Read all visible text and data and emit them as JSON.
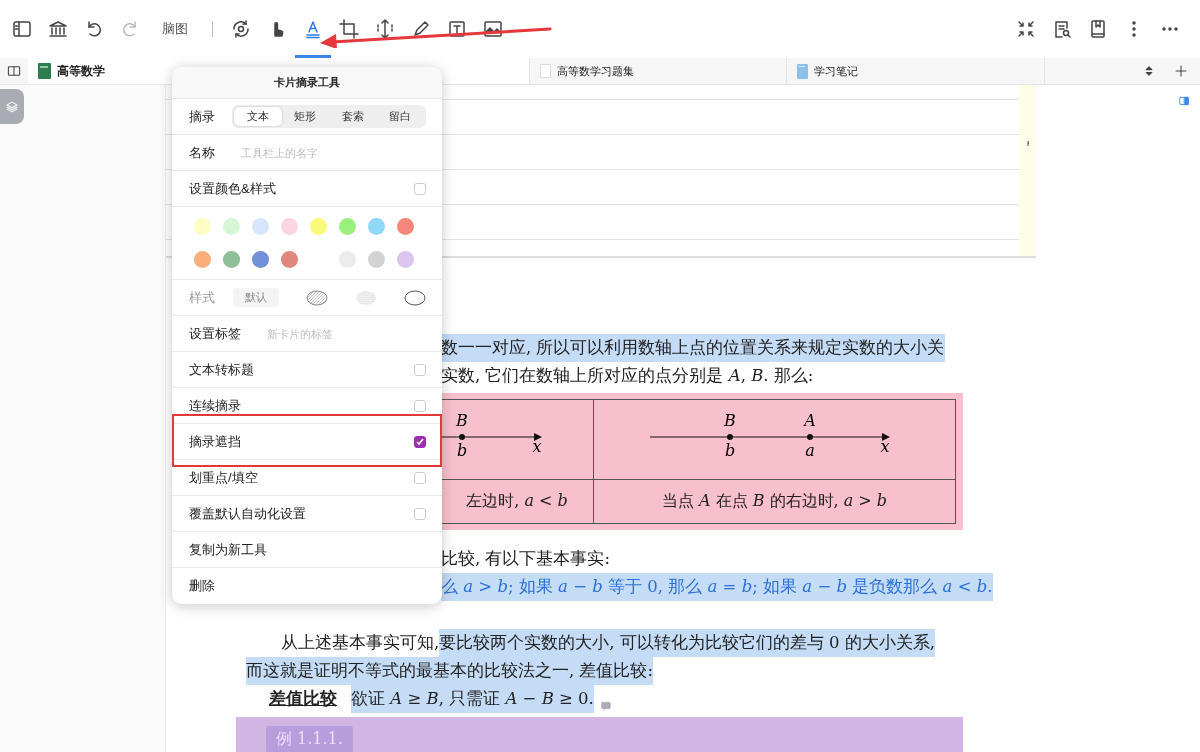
{
  "toolbar": {
    "history": [
      {
        "disabled": false
      },
      {
        "disabled": true
      }
    ],
    "mode_button": "脑图",
    "tools": [
      {
        "selected": false
      },
      {
        "selected": false
      },
      {
        "selected": true
      },
      {
        "selected": false
      },
      {
        "selected": false
      },
      {
        "selected": false
      },
      {
        "selected": false
      },
      {
        "selected": false
      }
    ]
  },
  "tabs": [
    {
      "kind": "book",
      "label": "高等数学",
      "selected": true
    },
    {
      "kind": "page",
      "label": "高等数学习题集",
      "selected": false
    },
    {
      "kind": "notebook",
      "label": "学习笔记",
      "selected": false
    }
  ],
  "document": {
    "lines": [
      {
        "kind": "fragment",
        "segments": [
          {
            "kind": "highlight",
            "text": "数一一对应, 所以可以利用数轴上点的位置关系来规定实数的大小关"
          }
        ]
      },
      {
        "kind": "fragment",
        "segments": [
          {
            "kind": "plain",
            "text": "实数, 它们在数轴上所对应的点分别是 *A*, *B*. 那么:"
          }
        ]
      }
    ],
    "table": {
      "diagrams": [
        {
          "axis": "x",
          "points": [
            {
              "above": "B",
              "below": "b"
            }
          ]
        },
        {
          "axis": "x",
          "points": [
            {
              "above": "B",
              "below": "b"
            },
            {
              "above": "A",
              "below": "a"
            }
          ]
        }
      ],
      "captions": [
        "左边时, *a* < *b*",
        "当点 *A* 在点 *B* 的右边时, *a* > *b*"
      ]
    },
    "lines_after": [
      {
        "kind": "fragment",
        "segments": [
          {
            "kind": "plain",
            "text": "比较, 有以下基本事实:"
          }
        ]
      },
      {
        "kind": "fragment",
        "segments": [
          {
            "kind": "highlight-blue",
            "text": "么 *a* > *b*; 如果 *a* − *b* 等于 0, 那么 *a* = *b*; 如果 *a* − *b* 是负数那么 *a* < *b*."
          }
        ]
      },
      {
        "kind": "blank"
      },
      {
        "kind": "indent",
        "segments": [
          {
            "kind": "plain",
            "text": "从上述基本事实可知, "
          },
          {
            "kind": "highlight",
            "text": "要比较两个实数的大小, 可以转化为比较它们的差与 0 的大小关系,"
          }
        ]
      },
      {
        "kind": "plain",
        "segments": [
          {
            "kind": "highlight",
            "text": "而这就是证明不等式的最基本的比较法之一, 差值比较:"
          }
        ]
      },
      {
        "kind": "definition",
        "segments": [
          {
            "kind": "term",
            "text": "差值比较"
          },
          {
            "kind": "highlight",
            "text": "欲证 *A* ≥ *B*, 只需证 *A* − *B* ≥ 0."
          }
        ]
      }
    ],
    "example": {
      "label": "例 1.1.1."
    }
  },
  "popup": {
    "title": "卡片摘录工具",
    "rows": [
      {
        "kind": "segmented",
        "label": "摘录",
        "options": [
          {
            "label": "文本",
            "selected": true
          },
          {
            "label": "矩形",
            "selected": false
          },
          {
            "label": "套索",
            "selected": false
          },
          {
            "label": "留白",
            "selected": false
          }
        ]
      },
      {
        "kind": "field",
        "label": "名称",
        "placeholder": "工具栏上的名字"
      },
      {
        "kind": "checkbox",
        "label": "设置颜色&样式",
        "checked": false
      },
      {
        "kind": "palette",
        "swatches": [
          {
            "kind": "swatch",
            "color": "#fdfdc4"
          },
          {
            "kind": "swatch",
            "color": "#d5f7d5"
          },
          {
            "kind": "swatch",
            "color": "#d7e6fb"
          },
          {
            "kind": "swatch",
            "color": "#fbd5df"
          },
          {
            "kind": "swatch",
            "color": "#fbf97a"
          },
          {
            "kind": "swatch",
            "color": "#9af07f"
          },
          {
            "kind": "swatch",
            "color": "#8fd8f8"
          },
          {
            "kind": "swatch",
            "color": "#f6857a"
          },
          {
            "kind": "swatch",
            "color": "#f9ae7c"
          },
          {
            "kind": "swatch",
            "color": "#8fbf97"
          },
          {
            "kind": "swatch",
            "color": "#7390d9"
          },
          {
            "kind": "swatch",
            "color": "#e0877d"
          },
          {
            "kind": "blank"
          },
          {
            "kind": "swatch",
            "color": "#ececec"
          },
          {
            "kind": "swatch",
            "color": "#d3d3d3"
          },
          {
            "kind": "swatch",
            "color": "#dbc5ee"
          }
        ]
      },
      {
        "kind": "styles",
        "label": "样式",
        "disabled": true,
        "options": [
          {
            "kind": "text",
            "label": "默认"
          },
          {
            "kind": "hatched"
          },
          {
            "kind": "dotted"
          },
          {
            "kind": "outline"
          }
        ]
      },
      {
        "kind": "field",
        "label": "设置标签",
        "placeholder": "新卡片的标签"
      },
      {
        "kind": "checkbox",
        "label": "文本转标题",
        "checked": false
      },
      {
        "kind": "checkbox",
        "label": "连续摘录",
        "checked": false
      },
      {
        "kind": "checkbox",
        "label": "摘录遮挡",
        "checked": true
      },
      {
        "kind": "checkbox",
        "label": "划重点/填空",
        "checked": false
      },
      {
        "kind": "checkbox",
        "label": "覆盖默认自动化设置",
        "checked": false
      },
      {
        "kind": "action",
        "label": "复制为新工具"
      },
      {
        "kind": "action",
        "label": "删除"
      }
    ]
  }
}
